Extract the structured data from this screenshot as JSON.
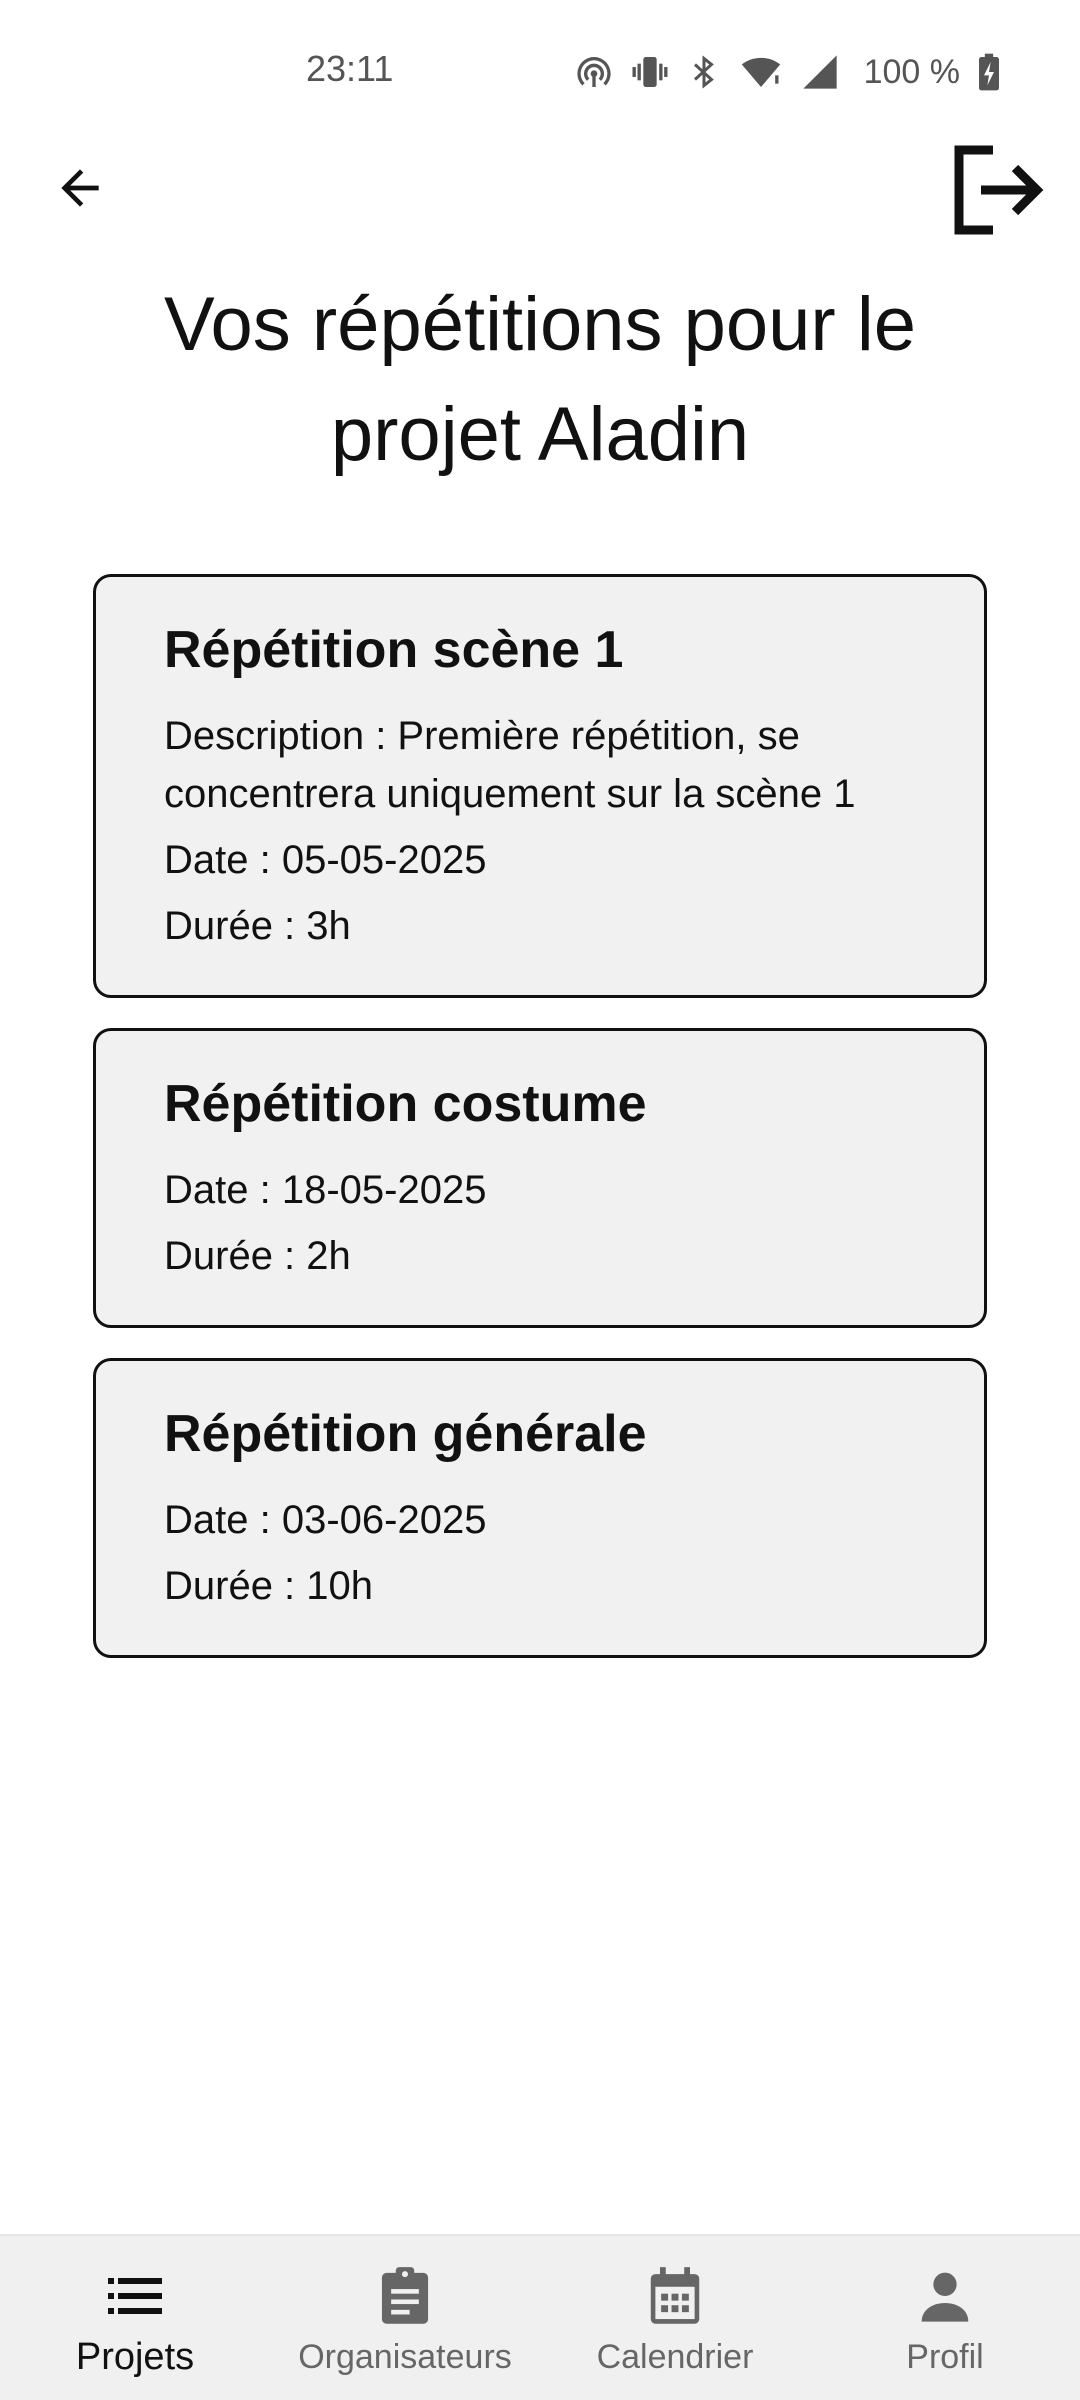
{
  "status_bar": {
    "time": "23:11",
    "battery_text": "100 %",
    "icons": [
      "hotspot-icon",
      "vibrate-icon",
      "bluetooth-icon",
      "wifi-icon",
      "signal-icon",
      "battery-charging-icon"
    ]
  },
  "header": {
    "back_icon": "arrow-left-icon",
    "logout_icon": "logout-icon",
    "title": "Vos répétitions pour le projet Aladin"
  },
  "rehearsals": [
    {
      "title": "Répétition scène 1",
      "description": "Description : Première répétition, se concentrera uniquement sur la scène 1",
      "date": "Date : 05-05-2025",
      "duration": "Durée : 3h"
    },
    {
      "title": "Répétition costume",
      "date": "Date : 18-05-2025",
      "duration": "Durée : 2h"
    },
    {
      "title": "Répétition générale",
      "date": "Date : 03-06-2025",
      "duration": "Durée : 10h"
    }
  ],
  "bottom_nav": {
    "items": [
      {
        "label": "Projets",
        "icon": "list-icon",
        "active": true
      },
      {
        "label": "Organisateurs",
        "icon": "clipboard-icon",
        "active": false
      },
      {
        "label": "Calendrier",
        "icon": "calendar-icon",
        "active": false
      },
      {
        "label": "Profil",
        "icon": "person-icon",
        "active": false
      }
    ]
  },
  "colors": {
    "card_background": "#f1f1f1",
    "card_border": "#111111",
    "nav_background": "#f0f0f0",
    "nav_active": "#111111",
    "nav_inactive": "#666666"
  }
}
